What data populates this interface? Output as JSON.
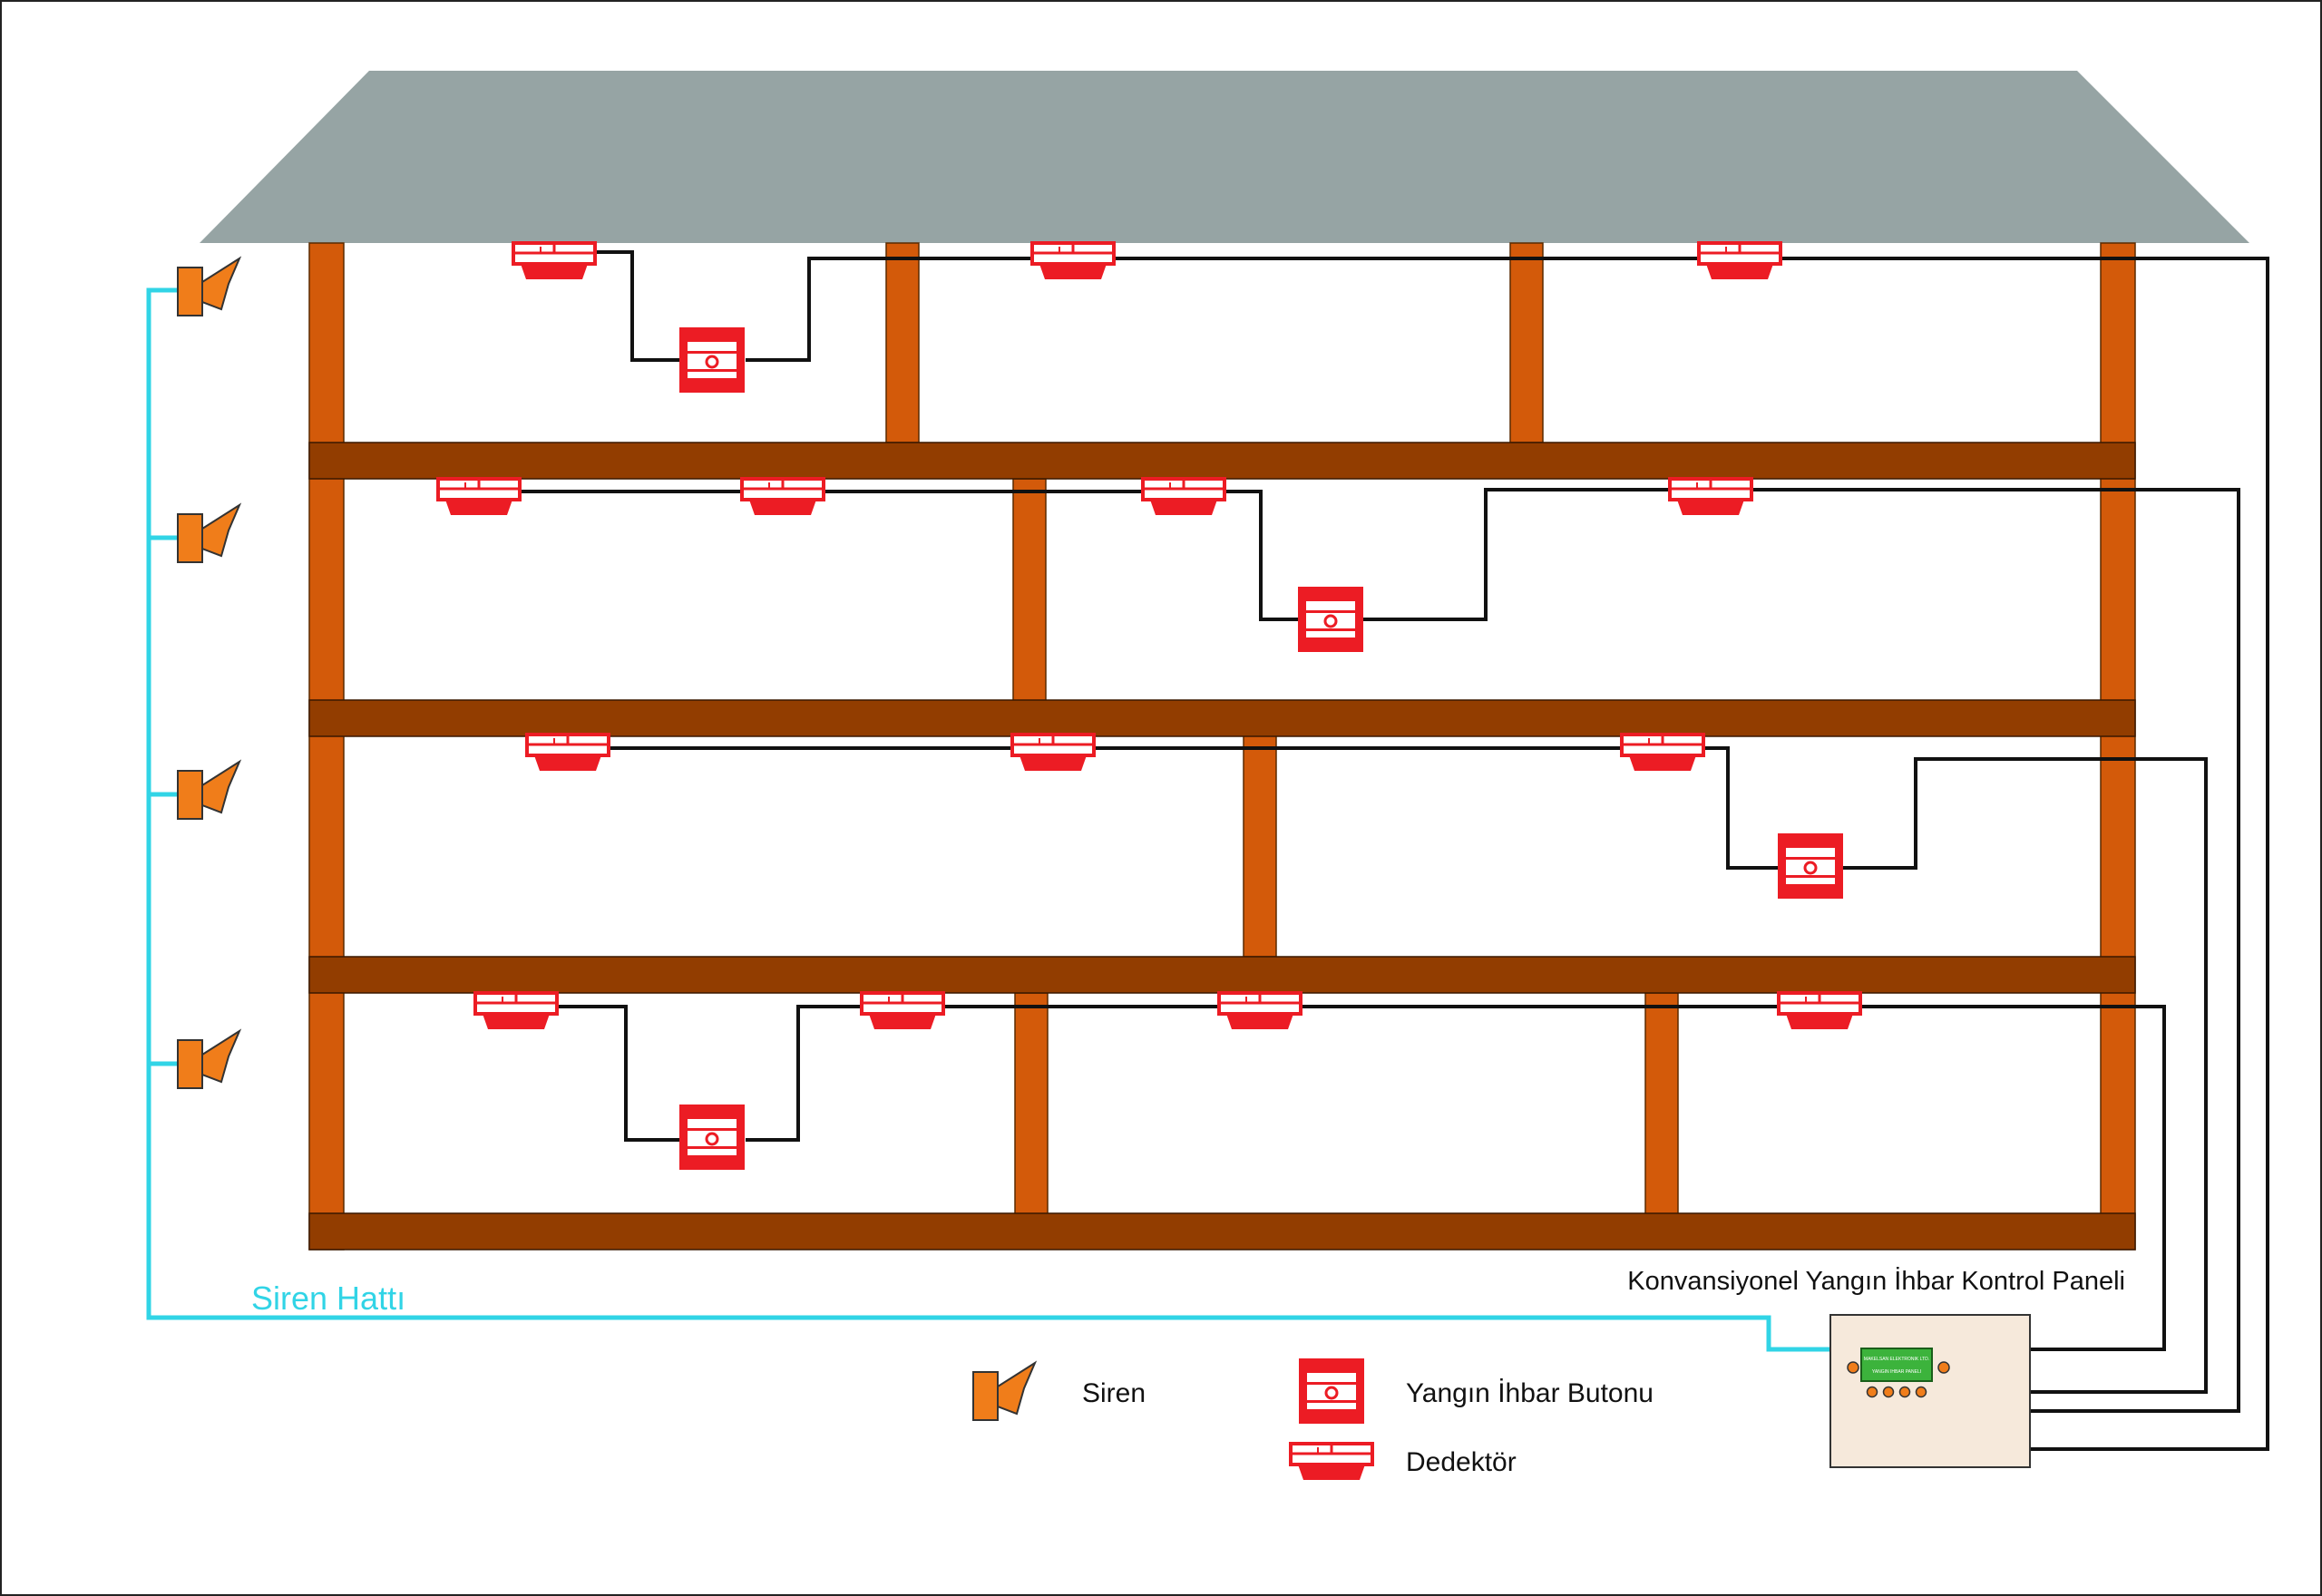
{
  "diagram": {
    "panel_title": "Konvansiyonel Yangın İhbar Kontrol Paneli",
    "siren_line_label": "Siren Hattı",
    "panel_display_line1": "MAKELSAN ELEKTRONIK LTD.",
    "panel_display_line2": "YANGIN IHBAR PANELI"
  },
  "legend": {
    "siren": "Siren",
    "button": "Yangın İhbar Butonu",
    "detector": "Dedektör"
  },
  "colors": {
    "roof": "#96a4a4",
    "post": "#d35a0a",
    "beam": "#923d00",
    "device_red": "#ec1c24",
    "siren_orange": "#f07d1a",
    "siren_line": "#31d4e6",
    "wire": "#111111",
    "panel_fill": "#f6e9db",
    "display_green": "#3cb33c"
  },
  "floors": [
    {
      "name": "floor-4",
      "detectors": 3,
      "call_points": 1
    },
    {
      "name": "floor-3",
      "detectors": 4,
      "call_points": 1
    },
    {
      "name": "floor-2",
      "detectors": 3,
      "call_points": 1
    },
    {
      "name": "floor-1",
      "detectors": 4,
      "call_points": 1
    }
  ]
}
